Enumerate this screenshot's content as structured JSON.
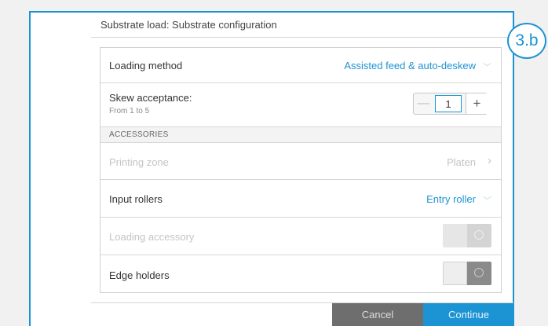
{
  "header": {
    "title": "Substrate load: Substrate configuration"
  },
  "step_badge": "3.b",
  "rows": {
    "loading_method": {
      "label": "Loading method",
      "value": "Assisted feed & auto-deskew"
    },
    "skew": {
      "label": "Skew acceptance:",
      "sublabel": "From 1 to 5",
      "value": "1",
      "minus": "—",
      "plus": "+"
    },
    "section": {
      "label": "ACCESSORIES"
    },
    "printing_zone": {
      "label": "Printing zone",
      "value": "Platen"
    },
    "input_rollers": {
      "label": "Input rollers",
      "value": "Entry roller"
    },
    "loading_accessory": {
      "label": "Loading accessory",
      "state": "off",
      "enabled": false
    },
    "edge_holders": {
      "label": "Edge holders",
      "state": "off",
      "enabled": true
    }
  },
  "icons": {
    "chevron_down": "﹀",
    "chevron_right": "›"
  },
  "footer": {
    "cancel": "Cancel",
    "continue": "Continue"
  },
  "colors": {
    "accent": "#1c93d3",
    "cancel_bg": "#6e6e6e"
  }
}
